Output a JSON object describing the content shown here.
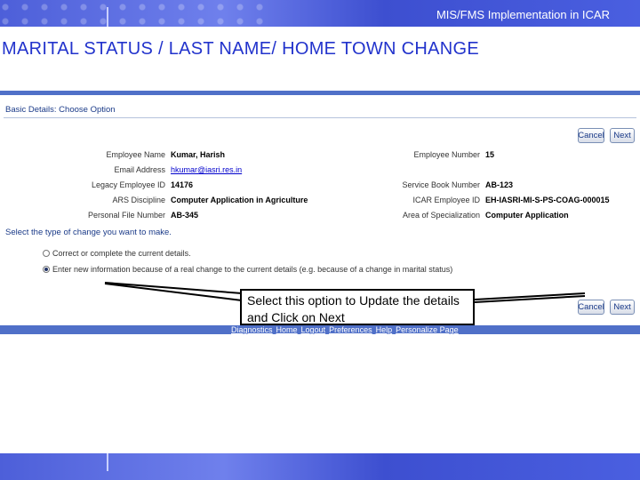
{
  "banner": {
    "title": "MIS/FMS Implementation in ICAR"
  },
  "page_title": "MARITAL STATUS / LAST NAME/ HOME TOWN CHANGE",
  "form": {
    "section_heading": "Basic Details: Choose Option",
    "cancel_label": "Cancel",
    "next_label": "Next",
    "left_fields": [
      {
        "label": "Employee Name",
        "value": "Kumar, Harish"
      },
      {
        "label": "Email Address",
        "value": "hkumar@iasri.res.in"
      },
      {
        "label": "Legacy Employee ID",
        "value": "14176"
      },
      {
        "label": "ARS Discipline",
        "value": "Computer Application in Agriculture"
      },
      {
        "label": "Personal File Number",
        "value": "AB-345"
      }
    ],
    "right_fields": [
      {
        "label": "Employee Number",
        "value": "15"
      },
      {
        "label": "Service Book Number",
        "value": "AB-123"
      },
      {
        "label": "ICAR Employee ID",
        "value": "EH-IASRI-MI-S-PS-COAG-000015"
      },
      {
        "label": "Area of Specialization",
        "value": "Computer Application"
      }
    ],
    "prompt": "Select the type of change you want to make.",
    "options": [
      {
        "label": "Correct or complete the current details.",
        "selected": false
      },
      {
        "label": "Enter new information because of a real change to the current details (e.g. because of a change in marital status)",
        "selected": true
      }
    ],
    "footer_links": [
      "Diagnostics",
      "Home",
      "Logout",
      "Preferences",
      "Help",
      "Personalize Page"
    ]
  },
  "callout": {
    "text": "Select this option to Update the details and Click on Next"
  },
  "colors": {
    "title_blue": "#2233cc",
    "banner_blue": "#4d5fd9",
    "bar_blue": "#5070c8"
  }
}
